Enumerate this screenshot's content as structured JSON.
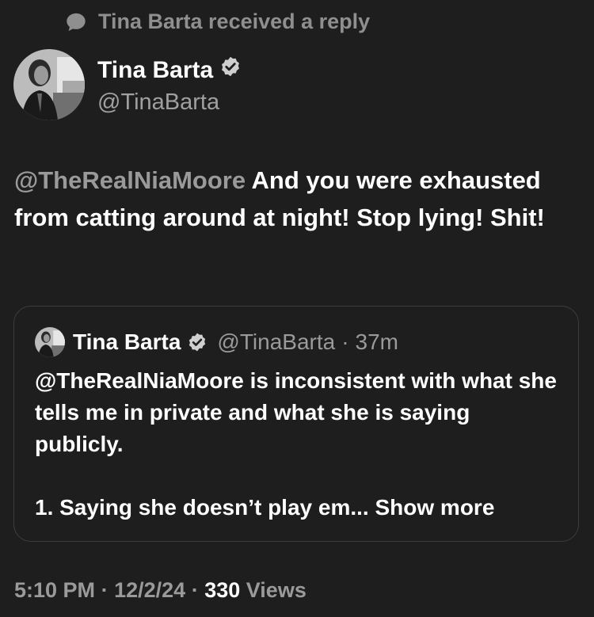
{
  "social_context": {
    "icon": "speech-bubble-icon",
    "text": "Tina Barta received a reply"
  },
  "author": {
    "name": "Tina Barta",
    "handle": "@TinaBarta",
    "verified_icon": "verified-badge-icon",
    "avatar": "avatar-photo"
  },
  "tweet": {
    "mention": "@TheRealNiaMoore",
    "text": " And you were exhausted from catting around at night! Stop lying!  Shit!"
  },
  "quote": {
    "name": "Tina Barta",
    "handle": "@TinaBarta",
    "separator": "·",
    "time": "37m",
    "line1": "@TheRealNiaMoore is inconsistent with what she tells me in private and what she is saying publicly.",
    "line2": "1.  Saying she doesn’t play em... Show more"
  },
  "meta": {
    "time": "5:10 PM",
    "sep1": "·",
    "date": "12/2/24",
    "sep2": "·",
    "views": "330",
    "views_label": "Views"
  },
  "colors": {
    "background": "#1e1e1e",
    "text": "#ffffff",
    "muted": "#9a9a9a",
    "border": "#3d3d3d"
  }
}
